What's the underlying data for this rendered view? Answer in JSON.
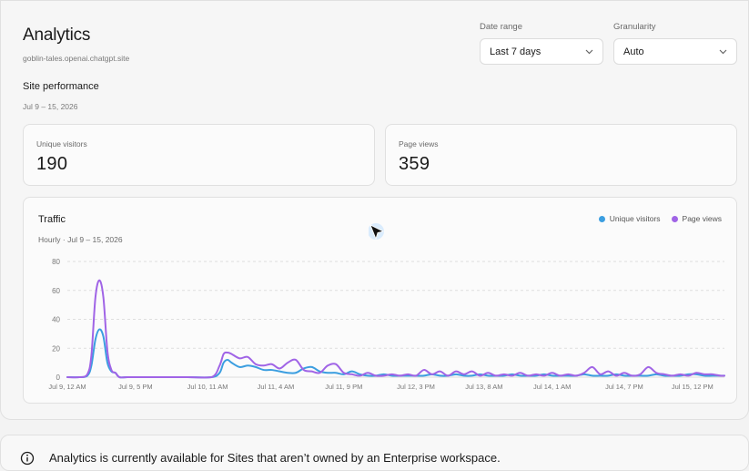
{
  "header": {
    "title": "Analytics",
    "subdomain": "goblin-tales.openai.chatgpt.site"
  },
  "controls": {
    "date_range_label": "Date range",
    "date_range_value": "Last 7 days",
    "granularity_label": "Granularity",
    "granularity_value": "Auto"
  },
  "section": {
    "title": "Site performance",
    "date": "Jul 9 – 15, 2026"
  },
  "metrics": [
    {
      "label": "Unique visitors",
      "value": "190"
    },
    {
      "label": "Page views",
      "value": "359"
    }
  ],
  "traffic": {
    "title": "Traffic",
    "subtitle": "Hourly · Jul 9 – 15, 2026",
    "legend": [
      {
        "name": "Unique visitors",
        "color": "#3b9ee0"
      },
      {
        "name": "Page views",
        "color": "#a064e6"
      }
    ]
  },
  "chart_data": {
    "type": "line",
    "title": "Traffic",
    "subtitle": "Hourly · Jul 9 – 15, 2026",
    "xlabel": "",
    "ylabel": "",
    "ylim": [
      0,
      80
    ],
    "yticks": [
      0,
      20,
      40,
      60,
      80
    ],
    "grid": true,
    "legend_position": "top-right",
    "x_tick_labels": [
      "Jul 9, 12 AM",
      "Jul 9, 5 PM",
      "Jul 10, 11 AM",
      "Jul 11, 4 AM",
      "Jul 11, 9 PM",
      "Jul 12, 3 PM",
      "Jul 13, 8 AM",
      "Jul 14, 1 AM",
      "Jul 14, 7 PM",
      "Jul 15, 12 PM"
    ],
    "x_tick_hours": [
      0,
      17,
      35,
      52,
      69,
      87,
      104,
      121,
      139,
      156
    ],
    "x_range_hours": [
      0,
      164
    ],
    "series": [
      {
        "name": "Unique visitors",
        "color": "#3b9ee0",
        "points": [
          [
            0,
            0
          ],
          [
            3,
            0
          ],
          [
            5,
            1
          ],
          [
            6,
            8
          ],
          [
            7,
            26
          ],
          [
            8,
            33
          ],
          [
            9,
            28
          ],
          [
            10,
            10
          ],
          [
            11,
            4
          ],
          [
            12,
            3
          ],
          [
            13,
            0
          ],
          [
            15,
            0
          ],
          [
            20,
            0
          ],
          [
            25,
            0
          ],
          [
            30,
            0
          ],
          [
            36,
            0
          ],
          [
            38,
            3
          ],
          [
            39,
            10
          ],
          [
            40,
            12
          ],
          [
            41,
            10
          ],
          [
            43,
            7
          ],
          [
            45,
            8
          ],
          [
            47,
            7
          ],
          [
            49,
            5
          ],
          [
            51,
            5
          ],
          [
            53,
            4
          ],
          [
            55,
            3
          ],
          [
            57,
            3
          ],
          [
            59,
            6
          ],
          [
            61,
            7
          ],
          [
            63,
            4
          ],
          [
            65,
            3
          ],
          [
            67,
            3
          ],
          [
            69,
            2
          ],
          [
            71,
            4
          ],
          [
            73,
            2
          ],
          [
            75,
            1
          ],
          [
            77,
            1
          ],
          [
            79,
            2
          ],
          [
            81,
            1
          ],
          [
            83,
            1
          ],
          [
            85,
            1
          ],
          [
            87,
            1
          ],
          [
            89,
            1
          ],
          [
            91,
            2
          ],
          [
            93,
            1
          ],
          [
            95,
            1
          ],
          [
            97,
            2
          ],
          [
            99,
            1
          ],
          [
            101,
            1
          ],
          [
            103,
            2
          ],
          [
            105,
            1
          ],
          [
            107,
            1
          ],
          [
            109,
            1
          ],
          [
            111,
            2
          ],
          [
            113,
            1
          ],
          [
            115,
            1
          ],
          [
            117,
            1
          ],
          [
            119,
            2
          ],
          [
            121,
            1
          ],
          [
            123,
            1
          ],
          [
            125,
            1
          ],
          [
            127,
            1
          ],
          [
            129,
            2
          ],
          [
            131,
            1
          ],
          [
            133,
            1
          ],
          [
            135,
            1
          ],
          [
            137,
            2
          ],
          [
            139,
            1
          ],
          [
            141,
            1
          ],
          [
            143,
            1
          ],
          [
            145,
            1
          ],
          [
            147,
            2
          ],
          [
            149,
            1
          ],
          [
            151,
            1
          ],
          [
            153,
            1
          ],
          [
            155,
            2
          ],
          [
            157,
            2
          ],
          [
            159,
            1
          ],
          [
            161,
            1
          ],
          [
            163,
            1
          ],
          [
            164,
            1
          ]
        ]
      },
      {
        "name": "Page views",
        "color": "#a064e6",
        "points": [
          [
            0,
            0
          ],
          [
            3,
            0
          ],
          [
            5,
            2
          ],
          [
            6,
            15
          ],
          [
            7,
            55
          ],
          [
            8,
            67
          ],
          [
            9,
            55
          ],
          [
            10,
            18
          ],
          [
            11,
            5
          ],
          [
            12,
            3
          ],
          [
            13,
            0
          ],
          [
            15,
            0
          ],
          [
            20,
            0
          ],
          [
            25,
            0
          ],
          [
            30,
            0
          ],
          [
            36,
            0
          ],
          [
            38,
            8
          ],
          [
            39,
            16
          ],
          [
            40,
            17
          ],
          [
            41,
            16
          ],
          [
            43,
            13
          ],
          [
            45,
            14
          ],
          [
            47,
            9
          ],
          [
            49,
            8
          ],
          [
            51,
            9
          ],
          [
            53,
            6
          ],
          [
            55,
            10
          ],
          [
            57,
            12
          ],
          [
            59,
            5
          ],
          [
            61,
            4
          ],
          [
            63,
            3
          ],
          [
            65,
            8
          ],
          [
            67,
            9
          ],
          [
            69,
            3
          ],
          [
            71,
            2
          ],
          [
            73,
            1
          ],
          [
            75,
            3
          ],
          [
            77,
            1
          ],
          [
            79,
            1
          ],
          [
            81,
            2
          ],
          [
            83,
            1
          ],
          [
            85,
            2
          ],
          [
            87,
            1
          ],
          [
            89,
            5
          ],
          [
            91,
            2
          ],
          [
            93,
            4
          ],
          [
            95,
            1
          ],
          [
            97,
            4
          ],
          [
            99,
            2
          ],
          [
            101,
            4
          ],
          [
            103,
            1
          ],
          [
            105,
            3
          ],
          [
            107,
            1
          ],
          [
            109,
            2
          ],
          [
            111,
            1
          ],
          [
            113,
            3
          ],
          [
            115,
            1
          ],
          [
            117,
            2
          ],
          [
            119,
            1
          ],
          [
            121,
            3
          ],
          [
            123,
            1
          ],
          [
            125,
            2
          ],
          [
            127,
            1
          ],
          [
            129,
            3
          ],
          [
            131,
            7
          ],
          [
            133,
            2
          ],
          [
            135,
            4
          ],
          [
            137,
            1
          ],
          [
            139,
            3
          ],
          [
            141,
            1
          ],
          [
            143,
            2
          ],
          [
            145,
            7
          ],
          [
            147,
            3
          ],
          [
            149,
            2
          ],
          [
            151,
            1
          ],
          [
            153,
            2
          ],
          [
            155,
            1
          ],
          [
            157,
            3
          ],
          [
            159,
            2
          ],
          [
            161,
            2
          ],
          [
            163,
            1
          ],
          [
            164,
            1
          ]
        ]
      }
    ]
  },
  "notice": {
    "text": "Analytics is currently available for Sites that aren’t owned by an Enterprise workspace."
  }
}
